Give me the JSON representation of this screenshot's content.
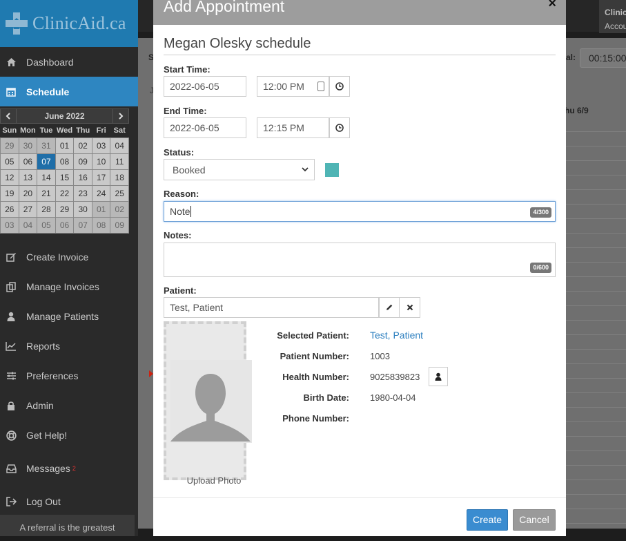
{
  "app": {
    "logo_text": "ClinicAid.ca",
    "account_label": "Clinic",
    "account_sub": "Accou"
  },
  "sidebar": {
    "items_top": [
      {
        "label": "Dashboard",
        "icon": "home-icon"
      },
      {
        "label": "Schedule",
        "icon": "calendar-icon",
        "active": true
      }
    ],
    "items_bottom": [
      {
        "label": "Create Invoice",
        "icon": "edit-icon"
      },
      {
        "label": "Manage Invoices",
        "icon": "copy-icon"
      },
      {
        "label": "Manage Patients",
        "icon": "user-icon"
      },
      {
        "label": "Reports",
        "icon": "chart-icon"
      },
      {
        "label": "Preferences",
        "icon": "sliders-icon"
      },
      {
        "label": "Admin",
        "icon": "lock-icon"
      },
      {
        "label": "Get Help!",
        "icon": "lifebuoy-icon"
      },
      {
        "label": "Messages",
        "icon": "inbox-icon",
        "count": "2"
      },
      {
        "label": "Log Out",
        "icon": "logout-icon"
      }
    ],
    "referral_text": "A referral is the greatest"
  },
  "mini_calendar": {
    "month": "June 2022",
    "weekdays": [
      "Sun",
      "Mon",
      "Tue",
      "Wed",
      "Thu",
      "Fri",
      "Sat"
    ],
    "weeks": [
      [
        "29",
        "30",
        "31",
        "01",
        "02",
        "03",
        "04"
      ],
      [
        "05",
        "06",
        "07",
        "08",
        "09",
        "10",
        "11"
      ],
      [
        "12",
        "13",
        "14",
        "15",
        "16",
        "17",
        "18"
      ],
      [
        "19",
        "20",
        "21",
        "22",
        "23",
        "24",
        "25"
      ],
      [
        "26",
        "27",
        "28",
        "29",
        "30",
        "01",
        "02"
      ],
      [
        "03",
        "04",
        "05",
        "06",
        "07",
        "08",
        "09"
      ]
    ],
    "selected": "07"
  },
  "background": {
    "interval_label": "al:",
    "interval_value": "00:15:00",
    "column_header": "hu 6/9",
    "s_label": "S",
    "j_label": "J"
  },
  "modal": {
    "title": "Add Appointment",
    "close": "×",
    "schedule_title": "Megan Olesky schedule",
    "start_label": "Start Time:",
    "start_date": "2022-06-05",
    "start_time": "12:00 PM",
    "end_label": "End Time:",
    "end_date": "2022-06-05",
    "end_time": "12:15 PM",
    "status_label": "Status:",
    "status_value": "Booked",
    "status_color": "#4fb5b5",
    "reason_label": "Reason:",
    "reason_value": "Note",
    "reason_count": "4/300",
    "notes_label": "Notes:",
    "notes_value": "",
    "notes_count": "0/600",
    "patient_label": "Patient:",
    "patient_value": "Test, Patient",
    "upload_label": "Upload Photo",
    "info": {
      "selected_patient_label": "Selected Patient:",
      "selected_patient": "Test, Patient",
      "patient_number_label": "Patient Number:",
      "patient_number": "1003",
      "health_number_label": "Health Number:",
      "health_number": "9025839823",
      "birth_date_label": "Birth Date:",
      "birth_date": "1980-04-04",
      "phone_label": "Phone Number:",
      "phone": ""
    },
    "create_label": "Create",
    "cancel_label": "Cancel"
  }
}
